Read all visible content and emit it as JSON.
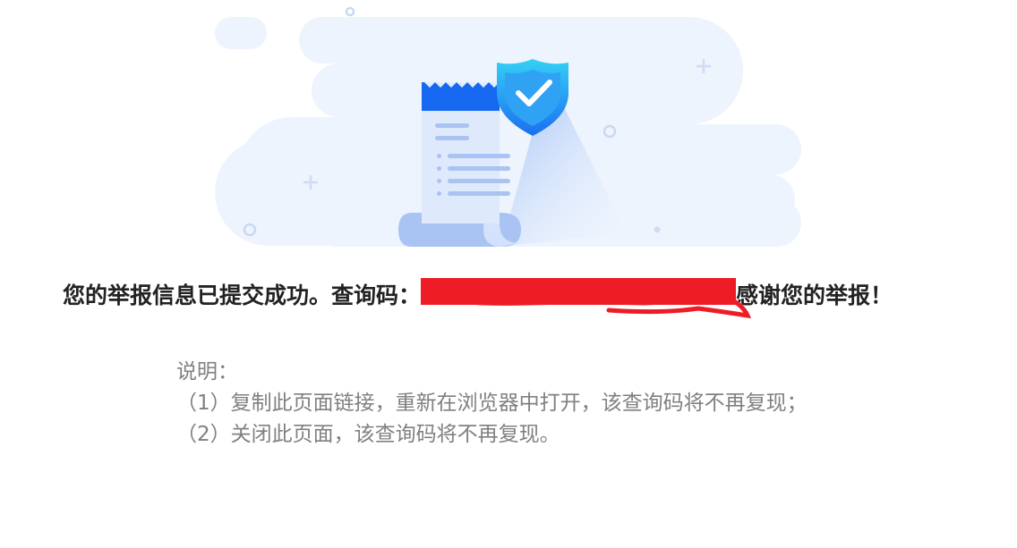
{
  "page": {
    "illustration_icon": "receipt-with-shield-checkmark-icon",
    "headline": {
      "prefix": "您的举报信息已提交成功。查询码：",
      "code_redaction_color": "#ee1c25",
      "suffix": "感谢您的举报！"
    },
    "notes": {
      "heading": "说明：",
      "items": [
        "（1）复制此页面链接，重新在浏览器中打开，该查询码将不再复现；",
        "（2）关闭此页面，该查询码将不再复现。"
      ]
    }
  },
  "colors": {
    "headline_text": "#222222",
    "notes_text": "#808080",
    "accent_blue": "#1677ff",
    "cloud": "#eef4fd"
  }
}
